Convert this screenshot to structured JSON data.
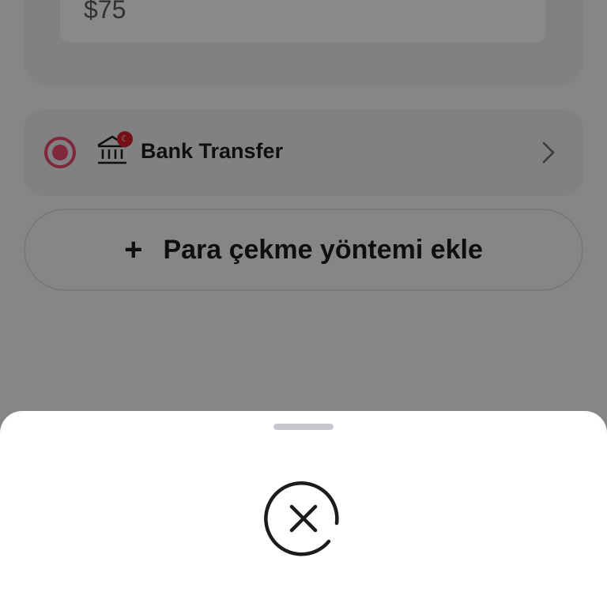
{
  "amount": {
    "value": "$75"
  },
  "payment_method": {
    "label": "Bank Transfer",
    "selected": true,
    "icon": "bank-icon",
    "badge_icon": "turkey-flag-icon",
    "accent_color": "#e8486c"
  },
  "add_method": {
    "label": "Para çekme yöntemi ekle",
    "icon": "plus-icon"
  },
  "bottom_sheet": {
    "status_icon": "close-circle-loading-icon"
  }
}
